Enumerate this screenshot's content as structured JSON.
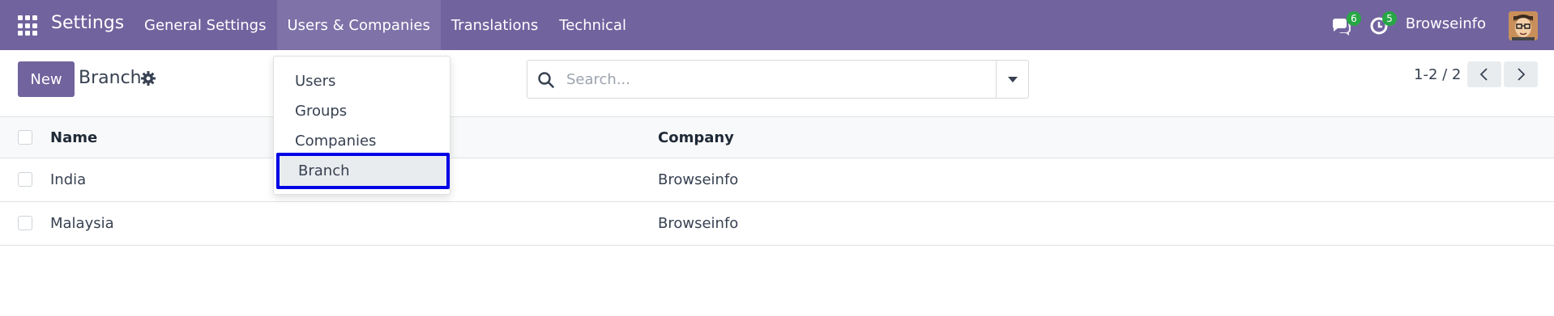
{
  "navbar": {
    "app_title": "Settings",
    "menu": [
      {
        "label": "General Settings"
      },
      {
        "label": "Users & Companies"
      },
      {
        "label": "Translations"
      },
      {
        "label": "Technical"
      }
    ],
    "chat_badge": "6",
    "activity_badge": "5",
    "user_name": "Browseinfo"
  },
  "control_panel": {
    "new_label": "New",
    "breadcrumb": "Branch",
    "search_placeholder": "Search...",
    "pager": "1-2 / 2"
  },
  "table": {
    "headers": {
      "name": "Name",
      "company": "Company"
    },
    "rows": [
      {
        "name": "India",
        "company": "Browseinfo"
      },
      {
        "name": "Malaysia",
        "company": "Browseinfo"
      }
    ]
  },
  "dropdown": {
    "items": [
      {
        "label": "Users"
      },
      {
        "label": "Groups"
      },
      {
        "label": "Companies"
      },
      {
        "label": "Branch"
      }
    ]
  },
  "colors": {
    "brand": "#71639e",
    "badge": "#28a745",
    "highlight_border": "#0000e6"
  }
}
